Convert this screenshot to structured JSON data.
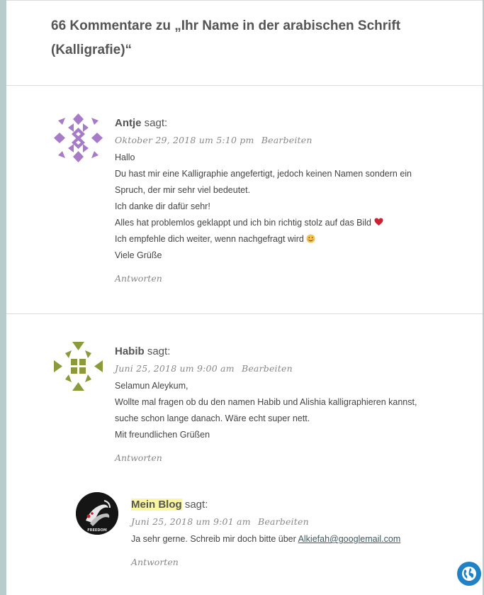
{
  "heading": "66 Kommentare zu „Ihr Name in der arabischen Schrift (Kalligrafie)“",
  "comments": [
    {
      "author": "Antje",
      "says": "sagt:",
      "date": "Oktober 29, 2018 um 5:10 pm",
      "edit": "Bearbeiten",
      "lines": [
        "Hallo",
        "Du hast mir eine Kalligraphie angefertigt, jedoch keinen Namen sondern ein",
        "Spruch, der mir sehr viel bedeutet.",
        "Ich danke dir dafür sehr!",
        "Alles hat problemlos geklappt und ich bin richtig stolz auf das Bild",
        "Ich empfehle dich weiter, wenn nachgefragt wird",
        "Viele Grüße"
      ],
      "reply": "Antworten"
    },
    {
      "author": "Habib",
      "says": "sagt:",
      "date": "Juni 25, 2018 um 9:00 am",
      "edit": "Bearbeiten",
      "lines": [
        "Selamun Aleykum,",
        "Wollte mal fragen ob du den namen Habib und Alishia kalligraphieren kannst,",
        "suche schon lange danach. Wäre echt super nett.",
        "Mit freundlichen Grüßen"
      ],
      "reply": "Antworten"
    },
    {
      "author": "Mein Blog",
      "says": "sagt:",
      "date": "Juni 25, 2018 um 9:01 am",
      "edit": "Bearbeiten",
      "text_prefix": "Ja sehr gerne. Schreib mir doch bitte über",
      "email": "Alkiefah@googlemail.com",
      "avatar_text": "FREEDOM",
      "reply": "Antworten"
    }
  ],
  "colors": {
    "avatar1": "#a77bc7",
    "avatar2": "#8c9a3c",
    "heart": "#d0202f",
    "highlight": "#fbf7a0",
    "globe": "#1f82c7"
  },
  "icons": [
    "heart-emoji-icon",
    "smile-emoji-icon",
    "globe-icon"
  ]
}
